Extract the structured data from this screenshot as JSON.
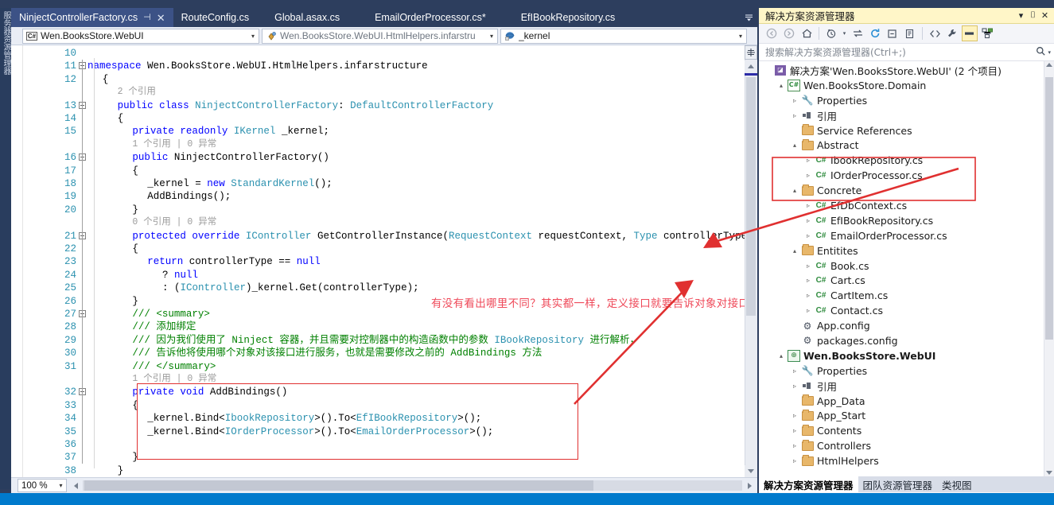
{
  "window": {
    "left_dock_label": "服务器资源管理器"
  },
  "tabs": [
    {
      "label": "NinjectControllerFactory.cs",
      "active": true,
      "pin": "⊣",
      "close": "✕"
    },
    {
      "label": "RouteConfig.cs",
      "active": false
    },
    {
      "label": "Global.asax.cs",
      "active": false
    },
    {
      "label": "EmailOrderProcessor.cs*",
      "active": false
    },
    {
      "label": "EfIBookRepository.cs",
      "active": false
    }
  ],
  "navbar": {
    "project": "Wen.BooksStore.WebUI",
    "project_icon": "csharp-icon",
    "type": "Wen.BooksStore.WebUI.HtmlHelpers.infarstru",
    "type_icon": "class-icon",
    "member": "_kernel",
    "member_icon": "field-private-icon",
    "arrow": "▾"
  },
  "code": {
    "lines": [
      {
        "num": "10",
        "indent": 0,
        "spans": []
      },
      {
        "num": "11",
        "indent": 0,
        "fold": "open",
        "spans": [
          {
            "t": "namespace ",
            "c": "kw"
          },
          {
            "t": "Wen.BooksStore.WebUI.HtmlHelpers.infarstructure",
            "c": ""
          }
        ]
      },
      {
        "num": "12",
        "indent": 1,
        "spans": [
          {
            "t": "{",
            "c": ""
          }
        ]
      },
      {
        "num": "",
        "indent": 2,
        "hint": true,
        "spans": [
          {
            "t": "2 个引用",
            "c": ""
          }
        ]
      },
      {
        "num": "13",
        "indent": 2,
        "fold": "open",
        "spans": [
          {
            "t": "public ",
            "c": "kw"
          },
          {
            "t": "class ",
            "c": "kw"
          },
          {
            "t": "NinjectControllerFactory",
            "c": "typ"
          },
          {
            "t": ": ",
            "c": ""
          },
          {
            "t": "DefaultControllerFactory",
            "c": "typ"
          }
        ]
      },
      {
        "num": "14",
        "indent": 2,
        "spans": [
          {
            "t": "{",
            "c": ""
          }
        ]
      },
      {
        "num": "15",
        "indent": 3,
        "spans": [
          {
            "t": "private ",
            "c": "kw"
          },
          {
            "t": "readonly ",
            "c": "kw"
          },
          {
            "t": "IKernel",
            "c": "typ"
          },
          {
            "t": " _kernel;",
            "c": ""
          }
        ]
      },
      {
        "num": "",
        "indent": 3,
        "hint": true,
        "spans": [
          {
            "t": "1 个引用 | 0 异常",
            "c": ""
          }
        ]
      },
      {
        "num": "16",
        "indent": 3,
        "fold": "open",
        "spans": [
          {
            "t": "public ",
            "c": "kw"
          },
          {
            "t": "NinjectControllerFactory()",
            "c": ""
          }
        ]
      },
      {
        "num": "17",
        "indent": 3,
        "spans": [
          {
            "t": "{",
            "c": ""
          }
        ]
      },
      {
        "num": "18",
        "indent": 4,
        "spans": [
          {
            "t": "_kernel = ",
            "c": ""
          },
          {
            "t": "new ",
            "c": "kw"
          },
          {
            "t": "StandardKernel",
            "c": "typ"
          },
          {
            "t": "();",
            "c": ""
          }
        ]
      },
      {
        "num": "19",
        "indent": 4,
        "spans": [
          {
            "t": "AddBindings();",
            "c": ""
          }
        ]
      },
      {
        "num": "20",
        "indent": 3,
        "spans": [
          {
            "t": "}",
            "c": ""
          }
        ]
      },
      {
        "num": "",
        "indent": 3,
        "hint": true,
        "spans": [
          {
            "t": "0 个引用 | 0 异常",
            "c": ""
          }
        ]
      },
      {
        "num": "21",
        "indent": 3,
        "fold": "open",
        "spans": [
          {
            "t": "protected ",
            "c": "kw"
          },
          {
            "t": "override ",
            "c": "kw"
          },
          {
            "t": "IController",
            "c": "typ"
          },
          {
            "t": " GetControllerInstance(",
            "c": ""
          },
          {
            "t": "RequestContext",
            "c": "typ"
          },
          {
            "t": " requestContext, ",
            "c": ""
          },
          {
            "t": "Type",
            "c": "typ"
          },
          {
            "t": " controllerType)",
            "c": ""
          }
        ]
      },
      {
        "num": "22",
        "indent": 3,
        "spans": [
          {
            "t": "{",
            "c": ""
          }
        ]
      },
      {
        "num": "23",
        "indent": 4,
        "spans": [
          {
            "t": "return ",
            "c": "kw"
          },
          {
            "t": "controllerType == ",
            "c": ""
          },
          {
            "t": "null",
            "c": "kw"
          }
        ]
      },
      {
        "num": "24",
        "indent": 5,
        "spans": [
          {
            "t": "? ",
            "c": ""
          },
          {
            "t": "null",
            "c": "kw"
          }
        ]
      },
      {
        "num": "25",
        "indent": 5,
        "spans": [
          {
            "t": ": (",
            "c": ""
          },
          {
            "t": "IController",
            "c": "typ"
          },
          {
            "t": ")_kernel.Get(controllerType);",
            "c": ""
          }
        ]
      },
      {
        "num": "26",
        "indent": 3,
        "spans": [
          {
            "t": "}",
            "c": ""
          }
        ]
      },
      {
        "num": "27",
        "indent": 3,
        "fold": "open",
        "spans": [
          {
            "t": "/// <summary>",
            "c": "cmt"
          }
        ]
      },
      {
        "num": "28",
        "indent": 3,
        "spans": [
          {
            "t": "/// 添加绑定",
            "c": "cmt"
          }
        ]
      },
      {
        "num": "29",
        "indent": 3,
        "spans": [
          {
            "t": "/// 因为我们使用了 Ninject 容器，并且需要对控制器中的构造函数中的参数 ",
            "c": "cmt"
          },
          {
            "t": "IBookRepository",
            "c": "typ"
          },
          {
            "t": " 进行解析，",
            "c": "cmt"
          }
        ]
      },
      {
        "num": "30",
        "indent": 3,
        "spans": [
          {
            "t": "/// 告诉他将使用哪个对象对该接口进行服务，也就是需要修改之前的 AddBindings 方法",
            "c": "cmt"
          }
        ]
      },
      {
        "num": "31",
        "indent": 3,
        "spans": [
          {
            "t": "/// </summary>",
            "c": "cmt"
          }
        ]
      },
      {
        "num": "",
        "indent": 3,
        "hint": true,
        "spans": [
          {
            "t": "1 个引用 | 0 异常",
            "c": ""
          }
        ]
      },
      {
        "num": "32",
        "indent": 3,
        "fold": "open",
        "spans": [
          {
            "t": "private ",
            "c": "kw"
          },
          {
            "t": "void ",
            "c": "kw"
          },
          {
            "t": "AddBindings()",
            "c": ""
          }
        ]
      },
      {
        "num": "33",
        "indent": 3,
        "spans": [
          {
            "t": "{",
            "c": ""
          }
        ]
      },
      {
        "num": "34",
        "indent": 4,
        "spans": [
          {
            "t": "_kernel.Bind<",
            "c": ""
          },
          {
            "t": "IbookRepository",
            "c": "typ"
          },
          {
            "t": ">().To<",
            "c": ""
          },
          {
            "t": "EfIBookRepository",
            "c": "typ"
          },
          {
            "t": ">();",
            "c": ""
          }
        ]
      },
      {
        "num": "35",
        "indent": 4,
        "spans": [
          {
            "t": "_kernel.Bind<",
            "c": ""
          },
          {
            "t": "IOrderProcessor",
            "c": "typ"
          },
          {
            "t": ">().To<",
            "c": ""
          },
          {
            "t": "EmailOrderProcessor",
            "c": "typ"
          },
          {
            "t": ">();",
            "c": ""
          }
        ]
      },
      {
        "num": "36",
        "indent": 4,
        "spans": []
      },
      {
        "num": "37",
        "indent": 3,
        "spans": [
          {
            "t": "}",
            "c": ""
          }
        ]
      },
      {
        "num": "38",
        "indent": 2,
        "spans": [
          {
            "t": "}",
            "c": ""
          }
        ]
      },
      {
        "num": "39",
        "indent": 1,
        "spans": [
          {
            "t": "}",
            "c": ""
          }
        ]
      }
    ]
  },
  "annotation": {
    "text": "有没有看出哪里不同？其实都一样，定义接口就要告诉对象对接口进行服务",
    "color": "#ef4a5a",
    "box_color": "#e03030"
  },
  "bottombar": {
    "zoom": "100 %",
    "zoom_arrow": "▾"
  },
  "solution_explorer": {
    "title": "解决方案资源管理器",
    "title_buttons": [
      "▾",
      "⌷",
      "✕"
    ],
    "toolbar_icons": [
      "back-icon",
      "forward-icon",
      "home-icon",
      "pending-changes-icon",
      "sync-icon",
      "refresh-icon",
      "collapse-all-icon",
      "show-all-files-icon",
      "view-code-icon",
      "properties-icon",
      "preview-selected-icon",
      "class-diagram-icon"
    ],
    "search_placeholder": "搜索解决方案资源管理器(Ctrl+;)",
    "search_icon": "search-icon",
    "tree": [
      {
        "depth": 0,
        "expander": "",
        "icon": "sln",
        "label": "解决方案'Wen.BooksStore.WebUI' (2 个项目)",
        "bold": false
      },
      {
        "depth": 1,
        "expander": "▴",
        "icon": "csproj",
        "label": "Wen.BooksStore.Domain",
        "bold": false
      },
      {
        "depth": 2,
        "expander": "▹",
        "icon": "wrench",
        "label": "Properties",
        "bold": false
      },
      {
        "depth": 2,
        "expander": "▹",
        "icon": "ref",
        "label": "引用",
        "bold": false
      },
      {
        "depth": 2,
        "expander": "",
        "icon": "folder",
        "label": "Service References",
        "bold": false
      },
      {
        "depth": 2,
        "expander": "▴",
        "icon": "folder",
        "label": "Abstract",
        "bold": false
      },
      {
        "depth": 3,
        "expander": "▹",
        "icon": "cs",
        "label": "IbookRepository.cs",
        "bold": false
      },
      {
        "depth": 3,
        "expander": "▹",
        "icon": "cs",
        "label": "IOrderProcessor.cs",
        "bold": false
      },
      {
        "depth": 2,
        "expander": "▴",
        "icon": "folder",
        "label": "Concrete",
        "bold": false
      },
      {
        "depth": 3,
        "expander": "▹",
        "icon": "cs",
        "label": "EfDbContext.cs",
        "bold": false
      },
      {
        "depth": 3,
        "expander": "▹",
        "icon": "cs",
        "label": "EfIBookRepository.cs",
        "bold": false
      },
      {
        "depth": 3,
        "expander": "▹",
        "icon": "cs",
        "label": "EmailOrderProcessor.cs",
        "bold": false
      },
      {
        "depth": 2,
        "expander": "▴",
        "icon": "folder",
        "label": "Entitites",
        "bold": false
      },
      {
        "depth": 3,
        "expander": "▹",
        "icon": "cs",
        "label": "Book.cs",
        "bold": false
      },
      {
        "depth": 3,
        "expander": "▹",
        "icon": "cs",
        "label": "Cart.cs",
        "bold": false
      },
      {
        "depth": 3,
        "expander": "▹",
        "icon": "cs",
        "label": "CartItem.cs",
        "bold": false
      },
      {
        "depth": 3,
        "expander": "▹",
        "icon": "cs",
        "label": "Contact.cs",
        "bold": false
      },
      {
        "depth": 2,
        "expander": "",
        "icon": "cfg",
        "label": "App.config",
        "bold": false
      },
      {
        "depth": 2,
        "expander": "",
        "icon": "cfg",
        "label": "packages.config",
        "bold": false
      },
      {
        "depth": 1,
        "expander": "▴",
        "icon": "web",
        "label": "Wen.BooksStore.WebUI",
        "bold": true
      },
      {
        "depth": 2,
        "expander": "▹",
        "icon": "wrench",
        "label": "Properties",
        "bold": false
      },
      {
        "depth": 2,
        "expander": "▹",
        "icon": "ref",
        "label": "引用",
        "bold": false
      },
      {
        "depth": 2,
        "expander": "",
        "icon": "folder",
        "label": "App_Data",
        "bold": false
      },
      {
        "depth": 2,
        "expander": "▹",
        "icon": "folder",
        "label": "App_Start",
        "bold": false
      },
      {
        "depth": 2,
        "expander": "▹",
        "icon": "folder",
        "label": "Contents",
        "bold": false
      },
      {
        "depth": 2,
        "expander": "▹",
        "icon": "folder",
        "label": "Controllers",
        "bold": false
      },
      {
        "depth": 2,
        "expander": "▹",
        "icon": "folder",
        "label": "HtmlHelpers",
        "bold": false
      }
    ],
    "bottom_tabs": [
      {
        "label": "解决方案资源管理器",
        "active": true
      },
      {
        "label": "团队资源管理器",
        "active": false
      },
      {
        "label": "类视图",
        "active": false
      }
    ]
  }
}
